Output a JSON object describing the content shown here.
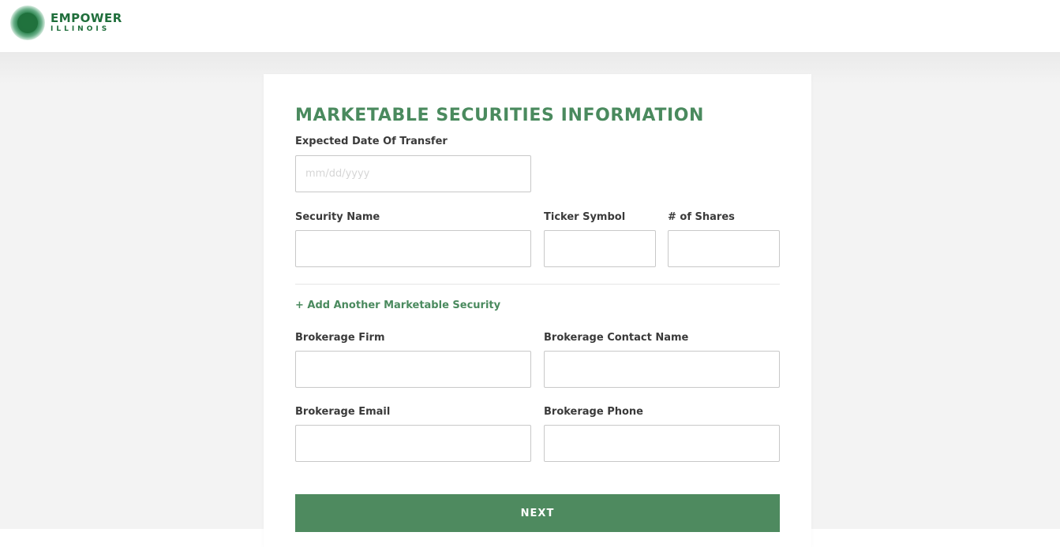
{
  "brand": {
    "name": "EMPOWER",
    "subname": "ILLINOIS",
    "color": "#1f6e3b"
  },
  "form": {
    "title": "MARKETABLE SECURITIES INFORMATION",
    "accent_color": "#4a8a5e",
    "expected_date": {
      "label": "Expected Date Of Transfer",
      "value": "",
      "placeholder": "mm/dd/yyyy"
    },
    "security_name": {
      "label": "Security Name",
      "value": ""
    },
    "ticker_symbol": {
      "label": "Ticker Symbol",
      "value": ""
    },
    "num_shares": {
      "label": "# of Shares",
      "value": ""
    },
    "add_security_link": "+ Add Another Marketable Security",
    "brokerage_firm": {
      "label": "Brokerage Firm",
      "value": ""
    },
    "brokerage_contact": {
      "label": "Brokerage Contact Name",
      "value": ""
    },
    "brokerage_email": {
      "label": "Brokerage Email",
      "value": ""
    },
    "brokerage_phone": {
      "label": "Brokerage Phone",
      "value": ""
    },
    "next_label": "NEXT",
    "button_color": "#4e8a5f"
  }
}
